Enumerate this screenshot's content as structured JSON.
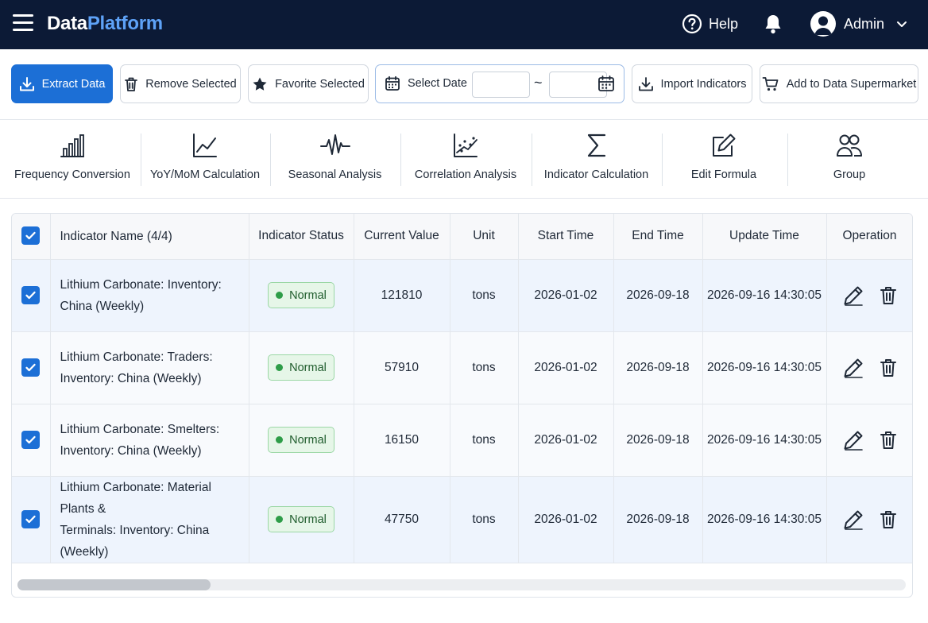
{
  "app": {
    "brand_part1": "Data",
    "brand_part2": "Platform",
    "brand_color": "#5ea2f7",
    "topbar_color": "#0c1a36"
  },
  "header": {
    "help_label": "Help",
    "user_name": "Admin",
    "icons": [
      "menu-icon",
      "help-icon",
      "bell-icon",
      "user-avatar",
      "chevron-down-icon"
    ]
  },
  "toolbar": {
    "extract_label": "Extract Data",
    "remove_label": "Remove Selected",
    "favorite_label": "Favorite Selected",
    "select_date_label": "Select Date",
    "date_from": "",
    "date_to": "",
    "date_separator": "~",
    "import_label": "Import Indicators",
    "supermarket_label": "Add to Data Supermarket",
    "accent": "#1c6fd6"
  },
  "tools": [
    {
      "label": "Frequency Conversion",
      "icon": "bar-chart-icon"
    },
    {
      "label": "YoY/MoM Calculation",
      "icon": "line-chart-icon"
    },
    {
      "label": "Seasonal Analysis",
      "icon": "waveform-icon"
    },
    {
      "label": "Correlation Analysis",
      "icon": "scatter-chart-icon"
    },
    {
      "label": "Indicator Calculation",
      "icon": "sigma-icon"
    },
    {
      "label": "Edit Formula",
      "icon": "edit-icon"
    },
    {
      "label": "Group",
      "icon": "group-icon"
    }
  ],
  "table": {
    "headers": [
      "Indicator Name (4/4)",
      "Indicator Status",
      "Current Value",
      "Unit",
      "Start Time",
      "End Time",
      "Update Time",
      "Operation"
    ],
    "rows": [
      {
        "checked": true,
        "name_line1": "Lithium Carbonate: Inventory:",
        "name_line2": "China (Weekly)",
        "status": "Normal",
        "value": "121810",
        "unit": "tons",
        "start": "2026-01-02",
        "end": "2026-09-18",
        "update": "2026-09-16 14:30:05"
      },
      {
        "checked": true,
        "name_line1": "Lithium Carbonate: Traders:",
        "name_line2": "Inventory: China (Weekly)",
        "status": "Normal",
        "value": "57910",
        "unit": "tons",
        "start": "2026-01-02",
        "end": "2026-09-18",
        "update": "2026-09-16 14:30:05"
      },
      {
        "checked": true,
        "name_line1": "Lithium Carbonate: Smelters:",
        "name_line2": "Inventory: China (Weekly)",
        "status": "Normal",
        "value": "16150",
        "unit": "tons",
        "start": "2026-01-02",
        "end": "2026-09-18",
        "update": "2026-09-16 14:30:05"
      },
      {
        "checked": true,
        "name_line1": "Lithium Carbonate: Material Plants &",
        "name_line2": "Terminals: Inventory: China (Weekly)",
        "status": "Normal",
        "value": "47750",
        "unit": "tons",
        "start": "2026-01-02",
        "end": "2026-09-18",
        "update": "2026-09-16 14:30:05"
      }
    ],
    "status_color": "#2e9d48",
    "row_actions": [
      "edit-icon",
      "delete-icon"
    ]
  }
}
